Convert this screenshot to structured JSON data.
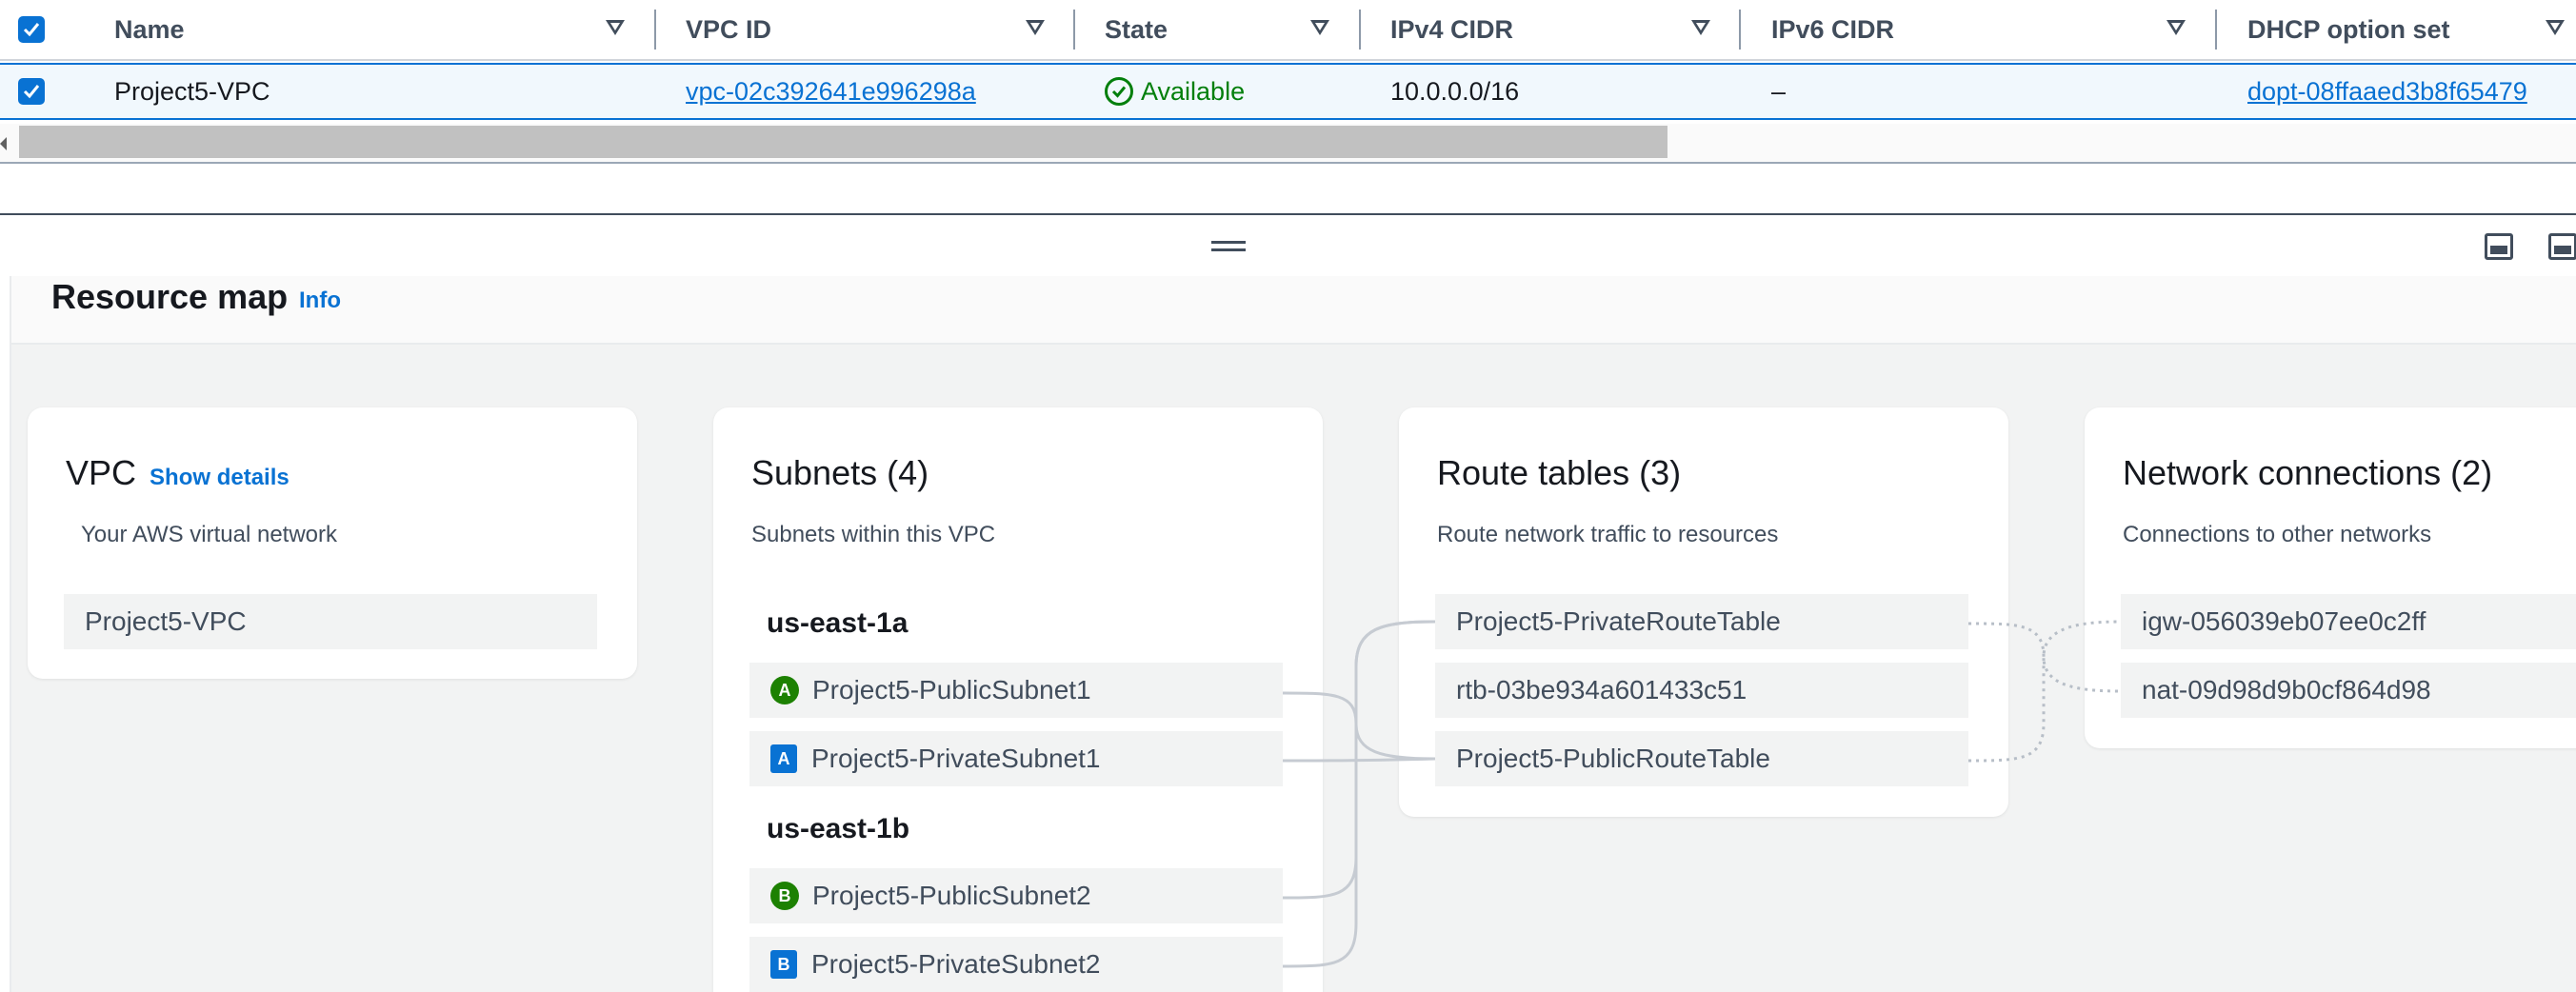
{
  "table": {
    "columns": [
      {
        "label": "Name"
      },
      {
        "label": "VPC ID"
      },
      {
        "label": "State"
      },
      {
        "label": "IPv4 CIDR"
      },
      {
        "label": "IPv6 CIDR"
      },
      {
        "label": "DHCP option set"
      }
    ],
    "row": {
      "selected": true,
      "name": "Project5-VPC",
      "vpc_id": "vpc-02c392641e996298a",
      "state": "Available",
      "ipv4_cidr": "10.0.0.0/16",
      "ipv6_cidr": "–",
      "dhcp_option_set": "dopt-08ffaaed3b8f65479"
    },
    "select_all_checked": true
  },
  "resource_map": {
    "title": "Resource map",
    "info_label": "Info",
    "vpc_card": {
      "title": "VPC",
      "show_details_label": "Show details",
      "subtitle": "Your AWS virtual network",
      "items": [
        "Project5-VPC"
      ]
    },
    "subnets_card": {
      "title": "Subnets (4)",
      "subtitle": "Subnets within this VPC",
      "zones": [
        {
          "name": "us-east-1a",
          "subnets": [
            {
              "badge": "A",
              "type": "public",
              "name": "Project5-PublicSubnet1"
            },
            {
              "badge": "A",
              "type": "private",
              "name": "Project5-PrivateSubnet1"
            }
          ]
        },
        {
          "name": "us-east-1b",
          "subnets": [
            {
              "badge": "B",
              "type": "public",
              "name": "Project5-PublicSubnet2"
            },
            {
              "badge": "B",
              "type": "private",
              "name": "Project5-PrivateSubnet2"
            }
          ]
        }
      ]
    },
    "route_tables_card": {
      "title": "Route tables (3)",
      "subtitle": "Route network traffic to resources",
      "items": [
        "Project5-PrivateRouteTable",
        "rtb-03be934a601433c51",
        "Project5-PublicRouteTable"
      ]
    },
    "network_connections_card": {
      "title": "Network connections (2)",
      "subtitle": "Connections to other networks",
      "items": [
        "igw-056039eb07ee0c2ff",
        "nat-09d98d9b0cf864d98"
      ]
    }
  },
  "colors": {
    "accent": "#0972d3",
    "available": "#037f0c",
    "public_badge": "#1d8102",
    "private_badge": "#0972d3"
  },
  "icons": {
    "sort": "caret-down-icon",
    "state_ok": "check-circle-icon",
    "checkbox": "checkbox-checked-icon",
    "drag": "drag-handle-icon",
    "panel_bottom": "panel-bottom-icon",
    "panel_side": "panel-side-icon"
  }
}
